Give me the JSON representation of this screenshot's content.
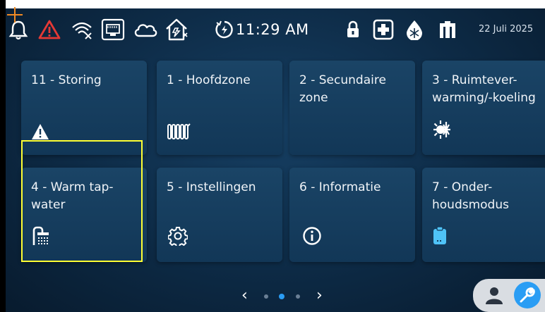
{
  "status_bar": {
    "icons": [
      "bell-icon",
      "alarm-warning-icon",
      "wifi-disconnected-icon",
      "ethernet-icon",
      "cloud-icon",
      "smart-home-icon",
      "boost-timer-icon",
      "lock-icon",
      "medical-cross-icon",
      "antifreeze-icon",
      "building-icon"
    ],
    "time": "11:29 AM",
    "date": "22 Juli 2025",
    "colors": {
      "alarm": "#e53935",
      "text": "#ffffff"
    }
  },
  "tiles": [
    {
      "label": "11 - Storing",
      "icon": "warning-icon"
    },
    {
      "label": "1 - Hoofdzone",
      "icon": "radiator-icon"
    },
    {
      "label": "2 - Secundaire zone",
      "icon": ""
    },
    {
      "label": "3 - Ruimtever-warming/-koeling",
      "icon": "heat-cool-icon"
    },
    {
      "label": "4 - Warm tap-water",
      "icon": "shower-icon"
    },
    {
      "label": "5 - Instellingen",
      "icon": "gear-icon"
    },
    {
      "label": "6 - Informatie",
      "icon": "info-icon"
    },
    {
      "label": "7 - Onder-houdsmodus",
      "icon": "clipboard-icon"
    }
  ],
  "pager": {
    "prev": "‹",
    "next": "›",
    "pages": 3,
    "active_page": 2
  },
  "user_panel": {
    "icons": [
      "user-icon",
      "wrench-icon"
    ],
    "accent": "#2a9df4"
  },
  "colors": {
    "highlight": "#ffff33",
    "clipboard": "#4fc3f7"
  }
}
